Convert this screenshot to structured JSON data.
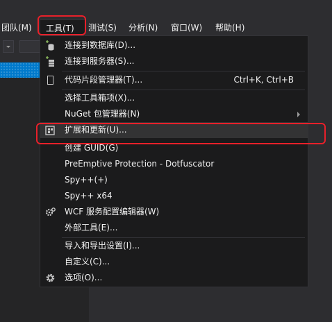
{
  "menubar": {
    "items": [
      {
        "label": "团队(M)"
      },
      {
        "label": "工具(T)"
      },
      {
        "label": "测试(S)"
      },
      {
        "label": "分析(N)"
      },
      {
        "label": "窗口(W)"
      },
      {
        "label": "帮助(H)"
      }
    ]
  },
  "tools_menu": {
    "items": [
      {
        "label": "连接到数据库(D)...",
        "icon": "connect-database-icon"
      },
      {
        "label": "连接到服务器(S)...",
        "icon": "connect-server-icon"
      },
      {
        "label": "代码片段管理器(T)...",
        "icon": "code-snippet-icon",
        "shortcut": "Ctrl+K, Ctrl+B"
      },
      {
        "label": "选择工具箱项(X)..."
      },
      {
        "label": "NuGet 包管理器(N)",
        "submenu": true
      },
      {
        "label": "扩展和更新(U)...",
        "icon": "extensions-icon"
      },
      {
        "label": "创建 GUID(G)"
      },
      {
        "label": "PreEmptive Protection - Dotfuscator"
      },
      {
        "label": "Spy++(+)"
      },
      {
        "label": "Spy++ x64"
      },
      {
        "label": "WCF 服务配置编辑器(W)",
        "icon": "wcf-config-icon"
      },
      {
        "label": "外部工具(E)..."
      },
      {
        "label": "导入和导出设置(I)..."
      },
      {
        "label": "自定义(C)..."
      },
      {
        "label": "选项(O)...",
        "icon": "gear-icon"
      }
    ]
  },
  "colors": {
    "background": "#2d2d30",
    "menu_background": "#1b1b1c",
    "highlight_outline": "#e8202a",
    "accent_blue": "#007acc"
  }
}
